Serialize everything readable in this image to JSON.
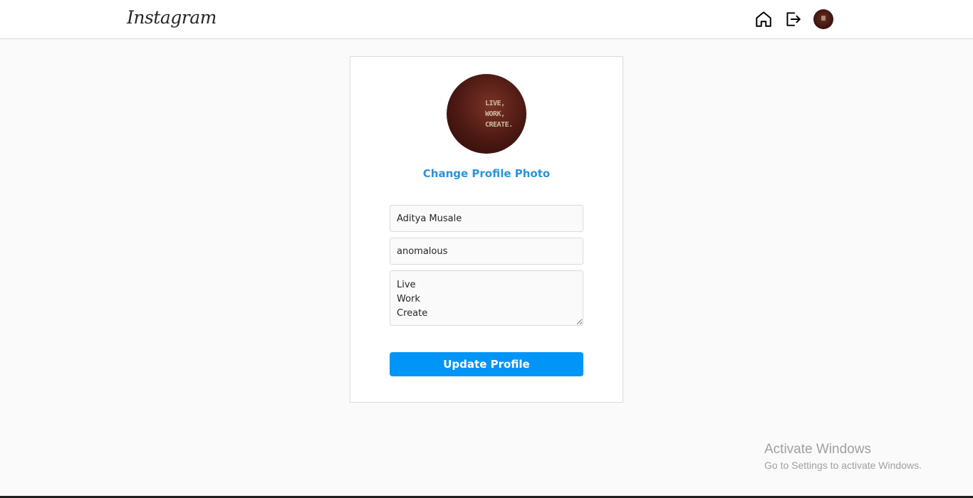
{
  "navbar": {
    "logo": "Instagram",
    "icons": [
      "home-icon",
      "logout-icon",
      "avatar"
    ]
  },
  "profile": {
    "photo_text": "LIVE,\nWORK,\nCREATE.",
    "change_photo_label": "Change Profile Photo",
    "name_value": "Aditya Musale",
    "username_value": "anomalous",
    "bio_value": "Live\nWork\nCreate",
    "update_button_label": "Update Profile"
  },
  "watermark": {
    "title": "Activate Windows",
    "subtitle": "Go to Settings to activate Windows."
  },
  "colors": {
    "accent_link": "#2b93d8",
    "button": "#0095f6",
    "background": "#fafafa",
    "border": "#dbdbdb"
  }
}
